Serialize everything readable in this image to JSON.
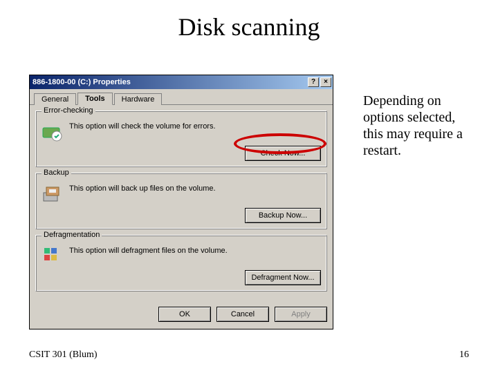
{
  "slide": {
    "title": "Disk scanning",
    "annotation": "Depending on options selected, this may require a restart.",
    "footer_left": "CSIT 301 (Blum)",
    "page_number": "16"
  },
  "dialog": {
    "title": "886-1800-00 (C:) Properties",
    "help_glyph": "?",
    "close_glyph": "×",
    "tabs": {
      "general": "General",
      "tools": "Tools",
      "hardware": "Hardware"
    },
    "groups": {
      "error_checking": {
        "legend": "Error-checking",
        "desc": "This option will check the volume for errors.",
        "button": "Check Now..."
      },
      "backup": {
        "legend": "Backup",
        "desc": "This option will back up files on the volume.",
        "button": "Backup Now..."
      },
      "defrag": {
        "legend": "Defragmentation",
        "desc": "This option will defragment files on the volume.",
        "button": "Defragment Now..."
      }
    },
    "buttons": {
      "ok": "OK",
      "cancel": "Cancel",
      "apply": "Apply"
    }
  }
}
